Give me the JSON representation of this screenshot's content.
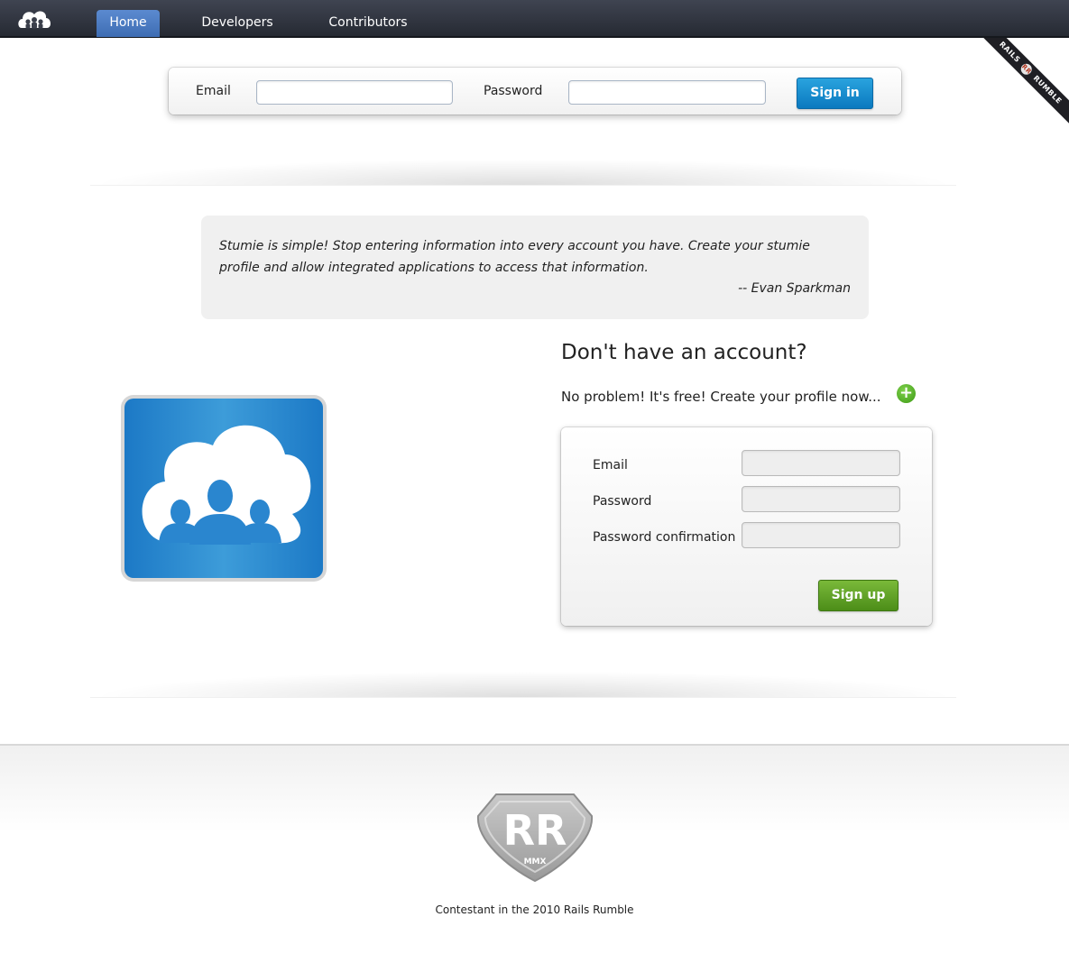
{
  "nav": {
    "logo_icon": "cloud-people-logo-icon",
    "items": [
      {
        "label": "Home",
        "active": true
      },
      {
        "label": "Developers",
        "active": false
      },
      {
        "label": "Contributors",
        "active": false
      }
    ]
  },
  "ribbon": {
    "text_left": "RAILS",
    "mark": "RR",
    "text_right": "RUMBLE"
  },
  "signin": {
    "email_label": "Email",
    "email_value": "",
    "password_label": "Password",
    "password_value": "",
    "button_label": "Sign in"
  },
  "quote": {
    "text": "Stumie is simple! Stop entering information into every account you have. Create your stumie profile and allow integrated applications to access that information.",
    "author": "-- Evan Sparkman"
  },
  "signup": {
    "title": "Don't have an account?",
    "subtitle": "No problem! It's free! Create your profile now...",
    "plus_icon": "plus-circle-icon",
    "email_label": "Email",
    "password_label": "Password",
    "password_confirmation_label": "Password confirmation",
    "button_label": "Sign up"
  },
  "footer": {
    "badge_letters": "RR",
    "badge_sub": "MMX",
    "text": "Contestant in the 2010 Rails Rumble"
  },
  "colors": {
    "accent_blue": "#0b79bf",
    "accent_green": "#4c8d18",
    "nav_dark": "#262a33",
    "logo_blue": "#1c79c6"
  }
}
